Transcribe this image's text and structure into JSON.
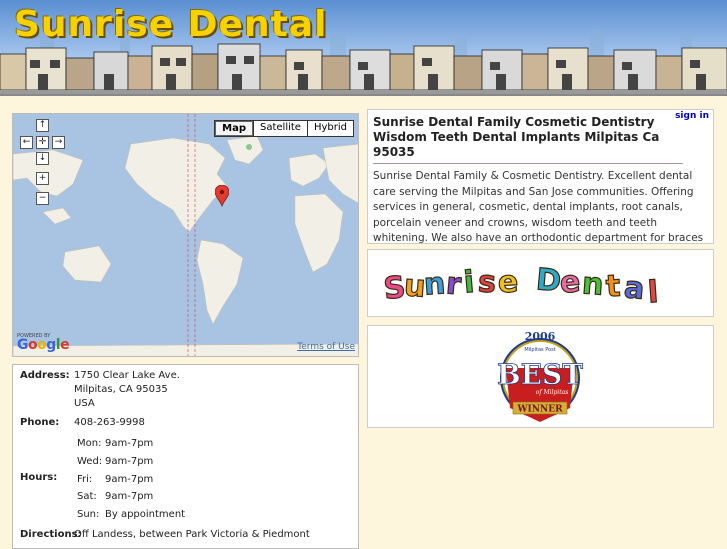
{
  "header": {
    "title": "Sunrise Dental"
  },
  "map": {
    "pan_up": "↑",
    "pan_left": "←",
    "pan_center": "✛",
    "pan_right": "→",
    "pan_down": "↓",
    "zoom_in": "+",
    "zoom_out": "−",
    "types": [
      {
        "label": "Map",
        "selected": true
      },
      {
        "label": "Satellite",
        "selected": false
      },
      {
        "label": "Hybrid",
        "selected": false
      }
    ],
    "powered_by": "POWERED BY",
    "google": "Google",
    "terms": "Terms of Use"
  },
  "description": {
    "signin": "sign in",
    "title": "Sunrise Dental Family Cosmetic Dentistry Wisdom Teeth Dental Implants Milpitas Ca 95035",
    "text": "Sunrise Dental Family & Cosmetic Dentistry. Excellent dental care serving the Milpitas and San Jose communities. Offering services in general, cosmetic, dental implants, root canals, porcelain veneer and crowns, wisdom teeth and teeth whitening. We also have an orthodontic department for braces and invisalign. Spanish, Chinese, Vietnamese, Filipino, and English spoken."
  },
  "logo": {
    "text": "Sunrise Dental"
  },
  "award": {
    "year": "2006",
    "source": "Milpitas Post",
    "best": "BEST",
    "of": "of Milpitas",
    "winner": "WINNER"
  },
  "info": {
    "address_label": "Address:",
    "address_line1": "1750 Clear Lake Ave.",
    "address_line2": "Milpitas, CA 95035",
    "address_line3": "USA",
    "phone_label": "Phone:",
    "phone": "408-263-9998",
    "hours_label": "Hours:",
    "hours": [
      {
        "day": "Mon:",
        "time": "9am-7pm"
      },
      {
        "day": "Wed:",
        "time": "9am-7pm"
      },
      {
        "day": "Fri:",
        "time": "9am-7pm"
      },
      {
        "day": "Sat:",
        "time": "9am-7pm"
      },
      {
        "day": "Sun:",
        "time": "By appointment"
      }
    ],
    "directions_label": "Directions:",
    "directions": "Off Landess, between Park Victoria & Piedmont"
  },
  "colors": {
    "title_yellow": "#f5d200",
    "map_water": "#a9c4e3",
    "map_land": "#f2efe6",
    "link_blue": "#00c",
    "marker_red": "#e23c2e"
  }
}
